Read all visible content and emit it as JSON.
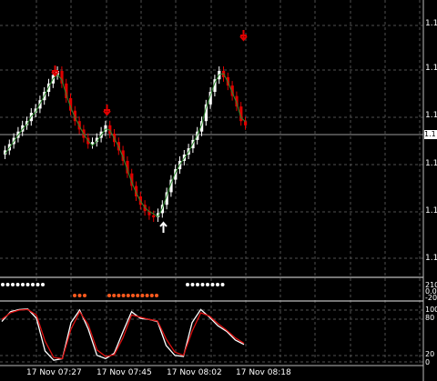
{
  "chart_data": [
    {
      "type": "candlestick",
      "title": "",
      "x_labels": [
        "17 Nov 07:27",
        "17 Nov 07:45",
        "17 Nov 08:02",
        "17 Nov 08:18"
      ],
      "y_tick_labels": [
        "1.1",
        "1.1",
        "1.1",
        "1.1",
        "1.1",
        "1.1"
      ],
      "current_price_label": "1.1",
      "grid": true,
      "candles_relative_close": [
        0.52,
        0.55,
        0.58,
        0.61,
        0.64,
        0.66,
        0.7,
        0.72,
        0.76,
        0.8,
        0.84,
        0.88,
        0.9,
        0.84,
        0.77,
        0.71,
        0.66,
        0.62,
        0.58,
        0.55,
        0.56,
        0.58,
        0.61,
        0.64,
        0.6,
        0.56,
        0.52,
        0.47,
        0.41,
        0.35,
        0.3,
        0.26,
        0.23,
        0.21,
        0.2,
        0.22,
        0.26,
        0.32,
        0.38,
        0.43,
        0.47,
        0.5,
        0.53,
        0.57,
        0.61,
        0.66,
        0.74,
        0.8,
        0.86,
        0.9,
        0.87,
        0.83,
        0.78,
        0.73,
        0.66,
        0.64
      ],
      "arrows": [
        "down",
        "down",
        "up",
        "down"
      ]
    },
    {
      "type": "dots",
      "y_tick_labels": [
        "210",
        "0.0",
        "-20"
      ],
      "white_dots": 14,
      "orange_dots": 20
    },
    {
      "type": "line",
      "series": [
        {
          "values": [
            74,
            92,
            96,
            97,
            80,
            20,
            3,
            6,
            72,
            95,
            60,
            12,
            6,
            16,
            55,
            92,
            80,
            78,
            74,
            30,
            12,
            10,
            72,
            96,
            82,
            66,
            56,
            40,
            32
          ]
        },
        {
          "values": [
            78,
            90,
            95,
            96,
            86,
            38,
            8,
            6,
            60,
            92,
            68,
            22,
            10,
            13,
            44,
            86,
            82,
            78,
            75,
            42,
            18,
            12,
            56,
            90,
            84,
            70,
            58,
            44,
            34
          ]
        }
      ],
      "y_tick_labels": [
        "100",
        "80",
        "20",
        "0"
      ]
    }
  ],
  "colors": {
    "grid": "#4f4f4f",
    "bull": "#ffffff",
    "bear": "#e00000",
    "ma": "#2e8b2e",
    "arrow_down": "#e00000",
    "arrow_up": "#ffffff",
    "dot_white": "#ffffff",
    "dot_orange": "#ff5a1e",
    "stoch_main": "#ffffff",
    "stoch_signal": "#dd1010",
    "separator": "#bdbdbd"
  }
}
